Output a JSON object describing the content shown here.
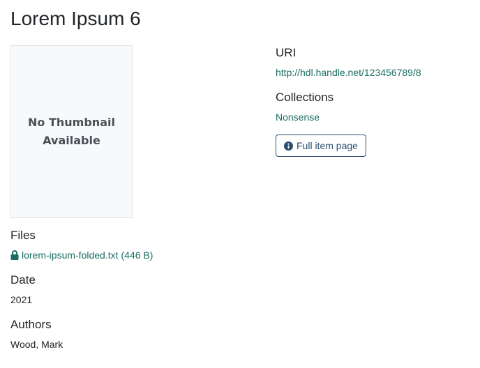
{
  "page": {
    "title": "Lorem Ipsum 6"
  },
  "thumbnail": {
    "text": "No Thumbnail Available"
  },
  "files": {
    "label": "Files",
    "file_name": "lorem-ipsum-folded.txt",
    "file_size": "(446 B)",
    "icon": "lock-icon"
  },
  "date": {
    "label": "Date",
    "value": "2021"
  },
  "authors": {
    "label": "Authors",
    "value": "Wood, Mark"
  },
  "uri": {
    "label": "URI",
    "value": "http://hdl.handle.net/123456789/8"
  },
  "collections": {
    "label": "Collections",
    "value": "Nonsense"
  },
  "full_item_button": {
    "label": "Full item page",
    "icon": "info-circle-icon"
  },
  "colors": {
    "link": "#1a6e61",
    "button_border": "#2b4e72",
    "text": "#212529"
  }
}
